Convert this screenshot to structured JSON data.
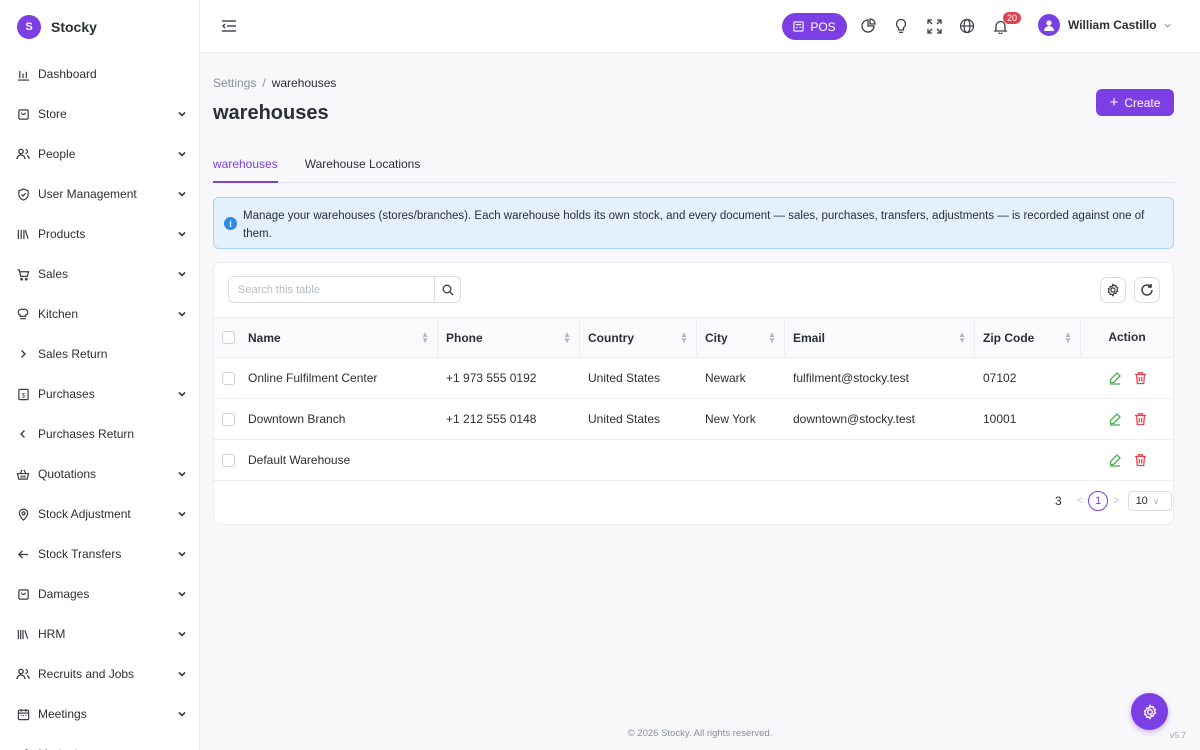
{
  "brand": {
    "name": "Stocky",
    "logo_letter": "S"
  },
  "sidebar": {
    "items": [
      {
        "label": "Dashboard",
        "icon": "bar-chart-icon",
        "expandable": false
      },
      {
        "label": "Store",
        "icon": "bag-icon",
        "expandable": true
      },
      {
        "label": "People",
        "icon": "users-icon",
        "expandable": true
      },
      {
        "label": "User Management",
        "icon": "shield-icon",
        "expandable": true
      },
      {
        "label": "Products",
        "icon": "books-icon",
        "expandable": true
      },
      {
        "label": "Sales",
        "icon": "cart-icon",
        "expandable": true
      },
      {
        "label": "Kitchen",
        "icon": "chef-hat-icon",
        "expandable": true
      },
      {
        "label": "Sales Return",
        "icon": "chevron-right-icon",
        "expandable": false
      },
      {
        "label": "Purchases",
        "icon": "receipt-icon",
        "expandable": true
      },
      {
        "label": "Purchases Return",
        "icon": "chevron-left-icon",
        "expandable": false
      },
      {
        "label": "Quotations",
        "icon": "basket-icon",
        "expandable": true
      },
      {
        "label": "Stock Adjustment",
        "icon": "pin-icon",
        "expandable": true
      },
      {
        "label": "Stock Transfers",
        "icon": "arrow-left-icon",
        "expandable": true
      },
      {
        "label": "Damages",
        "icon": "bag-icon",
        "expandable": true
      },
      {
        "label": "HRM",
        "icon": "library-icon",
        "expandable": true
      },
      {
        "label": "Recruits and Jobs",
        "icon": "users-icon",
        "expandable": true
      },
      {
        "label": "Meetings",
        "icon": "calendar-icon",
        "expandable": true
      },
      {
        "label": "Marketing",
        "icon": "megaphone-icon",
        "expandable": true
      }
    ]
  },
  "topbar": {
    "pos_label": "POS",
    "notifications_count": "20",
    "user_name": "William Castillo"
  },
  "breadcrumb": {
    "parent": "Settings",
    "separator": "/",
    "current": "warehouses"
  },
  "page": {
    "title": "warehouses",
    "create_label": "Create"
  },
  "tabs": [
    {
      "label": "warehouses",
      "active": true
    },
    {
      "label": "Warehouse Locations",
      "active": false
    }
  ],
  "alert": {
    "text": "Manage your warehouses (stores/branches). Each warehouse holds its own stock, and every document — sales, purchases, transfers, adjustments — is recorded against one of them."
  },
  "table": {
    "search_placeholder": "Search this table",
    "columns": [
      "Name",
      "Phone",
      "Country",
      "City",
      "Email",
      "Zip Code",
      "Action"
    ],
    "rows": [
      {
        "name": "Online Fulfilment Center",
        "phone": "+1 973 555 0192",
        "country": "United States",
        "city": "Newark",
        "email": "fulfilment@stocky.test",
        "zip": "07102"
      },
      {
        "name": "Downtown Branch",
        "phone": "+1 212 555 0148",
        "country": "United States",
        "city": "New York",
        "email": "downtown@stocky.test",
        "zip": "10001"
      },
      {
        "name": "Default Warehouse",
        "phone": "",
        "country": "",
        "city": "",
        "email": "",
        "zip": ""
      }
    ],
    "pagination": {
      "total": "3",
      "current_page": "1",
      "page_size": "10"
    }
  },
  "footer": {
    "copyright": "© 2026 Stocky. All rights reserved.",
    "version": "v5.7"
  },
  "colors": {
    "accent": "#7b3fe4",
    "danger": "#e0454f",
    "edit": "#4caf50",
    "info": "#2d8ae3"
  }
}
